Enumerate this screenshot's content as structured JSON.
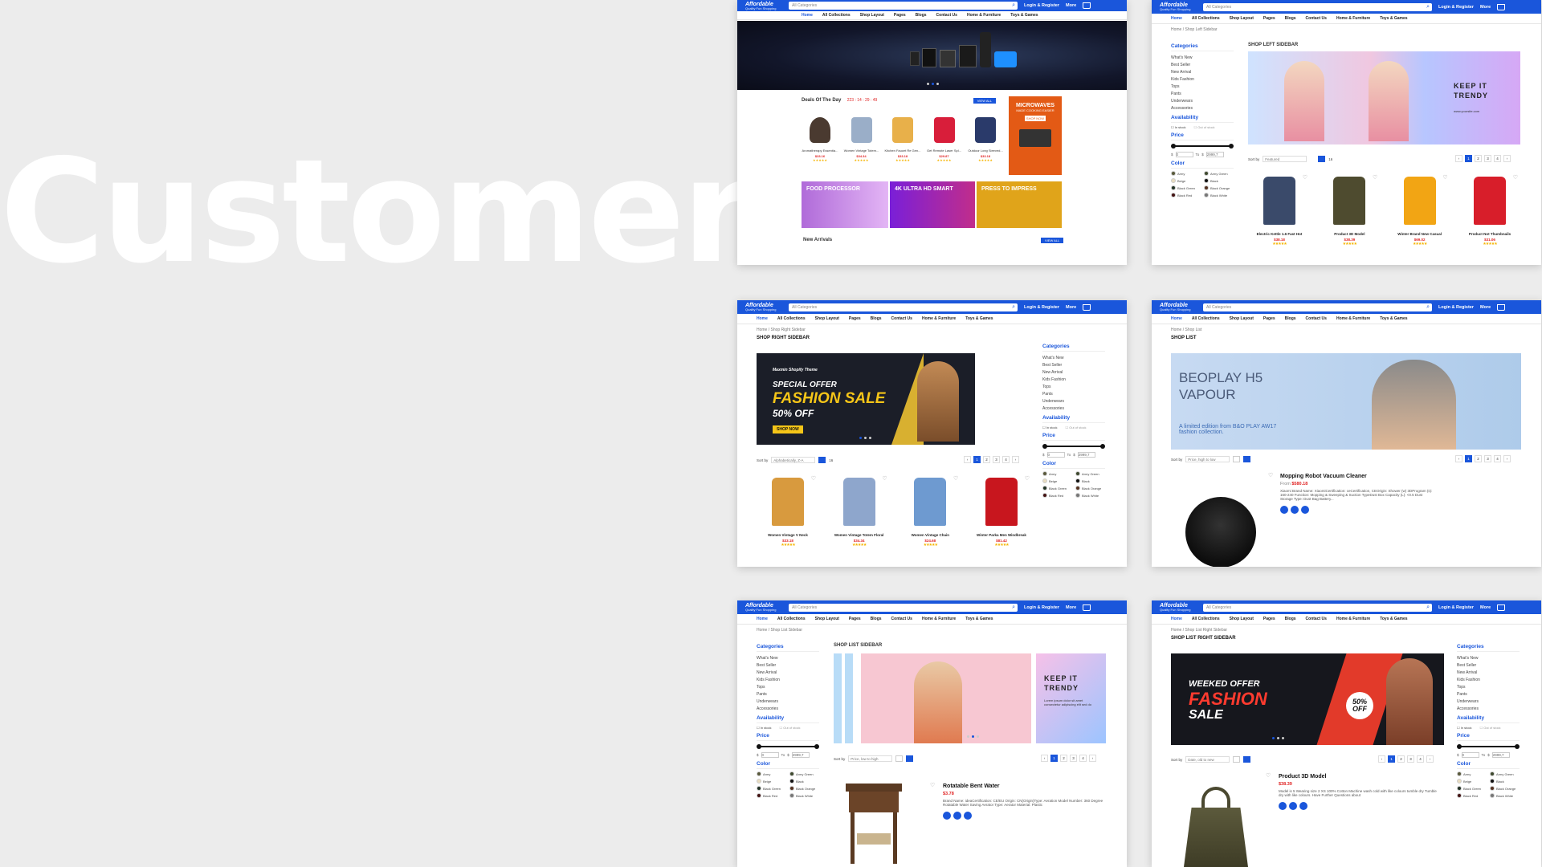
{
  "headline": "Customer",
  "common": {
    "logo_title": "Affordable",
    "logo_sub": "Quality Fun Shopping",
    "search_placeholder": "All Categories",
    "login": "Login & Register",
    "more": "More",
    "nav": [
      "Home",
      "All Collections",
      "Shop Layout",
      "Pages",
      "Blogs",
      "Contact Us",
      "Home & Furniture",
      "Toys & Games"
    ],
    "home_crumb": "Home",
    "sidebar": {
      "categories_title": "Categories",
      "categories": [
        "What's New",
        "Best Seller",
        "New Arrival",
        "Kids Fashion",
        "Tops",
        "Pants",
        "Underwears",
        "Accessories"
      ],
      "availability_title": "Availability",
      "in_stock": "In stock",
      "out_of_stock": "Out of stock",
      "price_title": "Price",
      "price_from": "0",
      "price_to_label": "To",
      "price_to": "2999,7",
      "currency": "$",
      "color_title": "Color",
      "colors": [
        {
          "name": "Army",
          "hex": "#5a5a3c"
        },
        {
          "name": "Army Green",
          "hex": "#3f4a2f"
        },
        {
          "name": "Beige",
          "hex": "#e8dcc0"
        },
        {
          "name": "Black",
          "hex": "#111111"
        },
        {
          "name": "Black Green",
          "hex": "#233326"
        },
        {
          "name": "Black Orange",
          "hex": "#553322"
        },
        {
          "name": "Black Red",
          "hex": "#441414"
        },
        {
          "name": "Black White",
          "hex": "#777777"
        }
      ]
    },
    "sort_by": "Sort by",
    "pages": [
      "1",
      "2",
      "3",
      "4"
    ]
  },
  "screens": {
    "home": {
      "deals_title": "Deals Of The Day",
      "deals_timer": "223 : 14 : 29 : 49",
      "view_all": "VIEW ALL",
      "products": [
        {
          "name": "Aromatherapy Essentia...",
          "price": "$33.16"
        },
        {
          "name": "Women Vintage Totem...",
          "price": "$34.34"
        },
        {
          "name": "Kitchen Faucet Re Gen...",
          "price": "$33.18"
        },
        {
          "name": "Get Remote Laser Spl...",
          "price": "$29.87"
        },
        {
          "name": "Outdoor Long Sleeved...",
          "price": "$33.18"
        }
      ],
      "promo_micro": "MICROWAVES",
      "promo_micro_sub": "MADE COOKING EASIER",
      "shop_now": "SHOP NOW",
      "tiles": [
        "FOOD PROCESSOR",
        "4K ULTRA HD SMART",
        "PRESS TO IMPRESS"
      ],
      "new_arrivals": "New Arrivals"
    },
    "left_sidebar": {
      "crumb": "Shop Left Sidebar",
      "title": "SHOP LEFT SIDEBAR",
      "banner_text": "KEEP IT TRENDY",
      "banner_url": "www.yoursite.com",
      "sort_value": "Featured",
      "count": "16",
      "products": [
        {
          "name": "Electric Kettle 1.6 Fast Hot",
          "price": "$38.18",
          "old": "$40.00"
        },
        {
          "name": "Product 3D Model",
          "price": "$38.39"
        },
        {
          "name": "Winter Brand New Casual",
          "price": "$69.02"
        },
        {
          "name": "Product Not Thumbnails",
          "price": "$31.06"
        }
      ]
    },
    "right_sidebar": {
      "crumb": "Shop Right Sidebar",
      "title": "SHOP RIGHT SIDEBAR",
      "banner_brand": "Maxmin Shopify Theme",
      "banner_line1": "SPECIAL OFFER",
      "banner_line2": "FASHION SALE",
      "banner_line3": "50% OFF",
      "shop_now": "SHOP NOW",
      "sort_value": "Alphabetically, Z-A",
      "count": "16",
      "products": [
        {
          "name": "Women Vintage V Neck",
          "price": "$33.18"
        },
        {
          "name": "Women Vintage Totem Floral",
          "price": "$34.34"
        },
        {
          "name": "Women Vintage Chain",
          "price": "$24.68"
        },
        {
          "name": "Winter Parka Men Windbreak",
          "price": "$81.42"
        }
      ]
    },
    "shop_list": {
      "crumb": "Shop List",
      "title": "SHOP LIST",
      "banner_line1": "BEOPLAY H5",
      "banner_line2": "VAPOUR",
      "banner_sub": "A limited edition from B&O PLAY AW17 fashion collection.",
      "sort_value": "Price, high to low",
      "product_name": "Mopping Robot Vacuum Cleaner",
      "product_price": "$580.18",
      "product_from": "From",
      "product_desc": "Xiaomi Brand Name: XiaomiCertification: ceCertification, CEOrigin: Shower (w) 3DProgram (s): 160-240 Function: Mopping & Sweeping & Suction TypeDust Box Capacity (L): <0.5 Dust Storage Type: Dust Bag Battery..."
    },
    "list_sidebar": {
      "crumb": "Shop List Sidebar",
      "title": "SHOP LIST SIDEBAR",
      "banner_text": "KEEP IT TRENDY",
      "banner_sub": "Lorem ipsum dolor sit amet consectetur adipiscing elit sed do",
      "sort_value": "Price, low to high",
      "product_name": "Rotatable Bent Water",
      "product_price": "$3.78",
      "product_desc": "Brand Name: ideaCertification: CE/EU Origin: CN(Origin)Type: Aeration Model Number: 360 Degree Rotatable Water Saving Aerator Type: Aerator Material: Plastic"
    },
    "list_right": {
      "crumb": "Shop List Right Sidebar",
      "title": "SHOP LIST RIGHT SIDEBAR",
      "banner_line1": "WEEKED OFFER",
      "banner_line2": "FASHION",
      "banner_line3": "SALE",
      "badge": "50% OFF",
      "sort_value": "Date, old to new",
      "product_name": "Product 3D Model",
      "product_price": "$38.39",
      "product_desc": "Model is 5 Wearing size 2 XS 100% Cotton Machine wash cold with like colours tumble dry Tumble dry with like colours. Have Further Questions about"
    }
  }
}
